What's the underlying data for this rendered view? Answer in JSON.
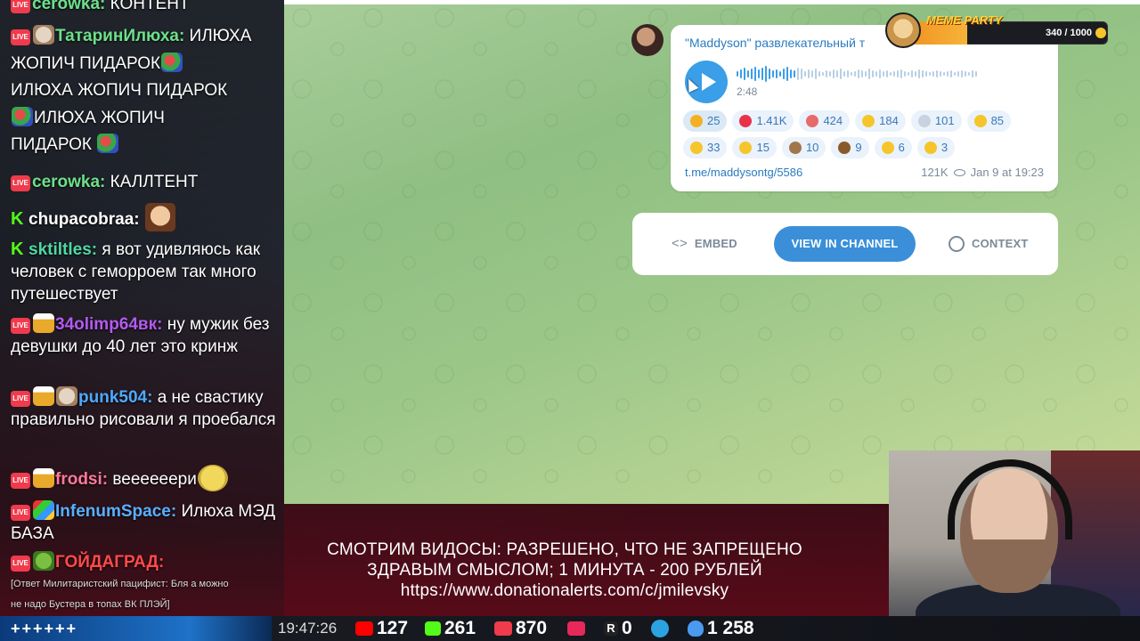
{
  "chat": {
    "messages": [
      {
        "platform": "live",
        "name": "cerowka:",
        "name_color": "#6de08a",
        "text": " КОНТЕНТ"
      },
      {
        "platform": "live",
        "name": "ТатаринИлюха:",
        "name_color": "#6de08a",
        "text": " ИЛЮХА ЖОПИЧ ПИДАРОК",
        "text2": " ИЛЮХА ЖОПИЧ ПИДАРОК",
        "text3": "ИЛЮХА ЖОПИЧ",
        "text4": "ПИДАРОК"
      },
      {
        "platform": "live",
        "name": "cerowka:",
        "name_color": "#6de08a",
        "text": " КАЛЛТЕНТ"
      },
      {
        "platform": "kick",
        "name": "chupacobraa:",
        "name_color": "#ffffff",
        "text": ""
      },
      {
        "platform": "kick",
        "name": "sktiltles:",
        "name_color": "#4fd8a3",
        "text": " я вот удивляюсь как человек с геморроем так много путешествует"
      },
      {
        "platform": "live",
        "name": "34olimp64вк:",
        "name_color": "#b45bf0",
        "text": " ну мужик без девушки до 40 лет это кринж"
      },
      {
        "platform": "live",
        "name": "punk504:",
        "name_color": "#4fa9ff",
        "text": " а не свастику правильно рисовали я проебался"
      },
      {
        "platform": "live",
        "name": "frodsi:",
        "name_color": "#ff7a9a",
        "text": " веееееери"
      },
      {
        "platform": "live",
        "name": "InfenumSpace:",
        "name_color": "#59b0ff",
        "text": " Илюха МЭД БАЗА"
      },
      {
        "platform": "live",
        "name": "ГОЙДАГРАД:",
        "name_color": "#ff4a4a",
        "text": ""
      }
    ],
    "reply_line1": "[Ответ Милитаристский пацифист: Бля а можно",
    "reply_line2": "не надо Бустера в топах ВК ПЛЭЙ]"
  },
  "telegram": {
    "post_title": "\"Maddyson\" развлекательный т",
    "duration": "2:48",
    "playback_progress": 0.25,
    "reactions": [
      {
        "icon": "star-icon",
        "color": "#f5b021",
        "count": "25",
        "selected": true
      },
      {
        "icon": "heart-icon",
        "color": "#e8324a",
        "count": "1.41K"
      },
      {
        "icon": "clown-icon",
        "color": "#e86a6a",
        "count": "424"
      },
      {
        "icon": "rofl-icon",
        "color": "#f5c52a",
        "count": "184"
      },
      {
        "icon": "heart-gray-icon",
        "color": "#c7d3df",
        "count": "101"
      },
      {
        "icon": "thumbs-up-icon",
        "color": "#f5c52a",
        "count": "85"
      },
      {
        "icon": "thinking-icon",
        "color": "#f5c52a",
        "count": "33"
      },
      {
        "icon": "clap-icon",
        "color": "#f5c52a",
        "count": "15"
      },
      {
        "icon": "monkey-icon",
        "color": "#a0764a",
        "count": "10"
      },
      {
        "icon": "poop-icon",
        "color": "#8a5a2a",
        "count": "9"
      },
      {
        "icon": "middle-finger-icon",
        "color": "#f5c52a",
        "count": "6"
      },
      {
        "icon": "thumbs-down-icon",
        "color": "#f5c52a",
        "count": "3"
      }
    ],
    "link": "t.me/maddysontg/5586",
    "views": "121K",
    "date": "Jan 9 at 19:23",
    "actions": {
      "embed": "EMBED",
      "view": "VIEW IN CHANNEL",
      "context": "CONTEXT"
    },
    "accent": "#3a8fd8"
  },
  "meme_party": {
    "title": "MEME PARTY",
    "score": "340 / 1000",
    "progress": 0.34
  },
  "notice": {
    "line1": "СМОТРИМ ВИДОСЫ: РАЗРЕШЕНО, ЧТО НЕ ЗАПРЕЩЕНО",
    "line2": "ЗДРАВЫМ СМЫСЛОМ; 1 МИНУТА - 200 РУБЛЕЙ",
    "line3": "https://www.donationalerts.com/c/jmilevsky"
  },
  "status": {
    "plus": "++++++",
    "clock": "19:47:26",
    "youtube": "127",
    "kick": "261",
    "vklive": "870",
    "other": "",
    "rutube": "0",
    "total": "1 258"
  }
}
